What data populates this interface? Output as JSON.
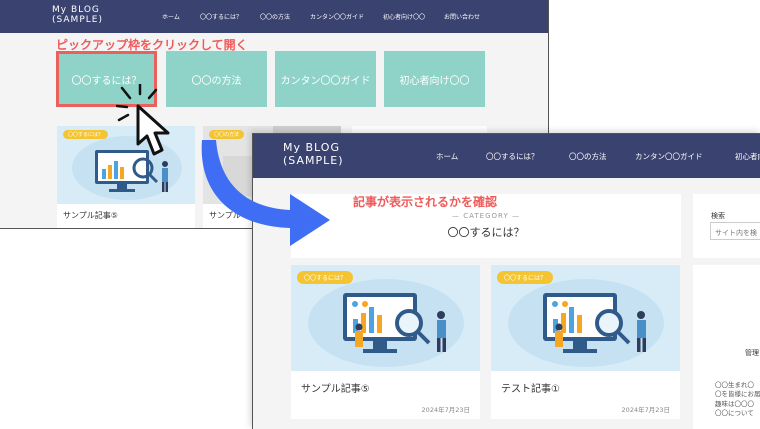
{
  "screenshot1": {
    "logo": "My BLOG\n(SAMPLE)",
    "nav": [
      "ホーム",
      "〇〇するには？",
      "〇〇の方法",
      "カンタン〇〇ガイド",
      "初心者向け〇〇",
      "お問い合わせ"
    ],
    "instruction": "ピックアップ枠をクリックして開く",
    "pickup": [
      "〇〇するには？",
      "〇〇の方法",
      "カンタン〇〇ガイド",
      "初心者向け〇〇"
    ],
    "cards": [
      {
        "badge": "〇〇するには？",
        "title": "サンプル記事⑤"
      },
      {
        "badge": "〇〇の方法",
        "title": "サンプル"
      }
    ]
  },
  "screenshot2": {
    "logo": "My BLOG\n(SAMPLE)",
    "nav": [
      "ホーム",
      "〇〇するには？",
      "〇〇の方法",
      "カンタン〇〇ガイド",
      "初心者向"
    ],
    "confirm_text": "記事が表示されるかを確認",
    "category_label": "— CATEGORY —",
    "category_name": "〇〇するには？",
    "cards": [
      {
        "badge": "〇〇するには？",
        "title": "サンプル記事⑤",
        "date": "2024年7月23日"
      },
      {
        "badge": "〇〇するには？",
        "title": "テスト記事①",
        "date": "2024年7月23日"
      }
    ],
    "sidebar": {
      "search_label": "検索",
      "search_placeholder": "サイト内を検",
      "admin": "管理",
      "profile_text": "〇〇生まれ〇\n〇を皆様にお届\n趣味は〇〇〇\n〇〇について"
    }
  },
  "colors": {
    "nav_bg": "#3a4270",
    "pickup_bg": "#8fd3c8",
    "highlight": "#e9605c",
    "annotation": "#ef5b5b",
    "badge": "#f5c432",
    "arrow": "#3f6ef4"
  },
  "icons": [
    "cursor-hand-icon",
    "curved-arrow-icon"
  ]
}
